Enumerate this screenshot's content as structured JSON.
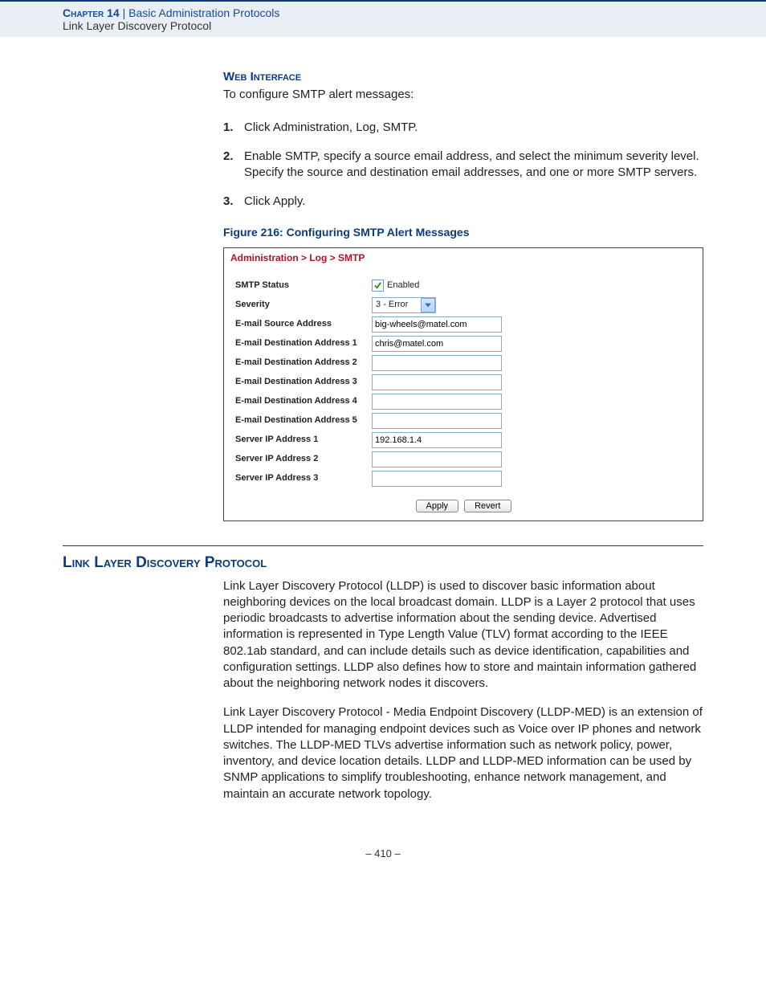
{
  "header": {
    "chapter_label": "Chapter 14",
    "separator": "  |  ",
    "chapter_title": "Basic Administration Protocols",
    "section": "Link Layer Discovery Protocol"
  },
  "web_interface": {
    "heading": "Web Interface",
    "intro": "To configure SMTP alert messages:",
    "steps": [
      "Click Administration, Log, SMTP.",
      "Enable SMTP, specify a source email address, and select the minimum severity level. Specify the source and destination email addresses, and one or more SMTP servers.",
      "Click Apply."
    ]
  },
  "figure": {
    "caption": "Figure 216:  Configuring SMTP Alert Messages",
    "breadcrumb": "Administration > Log > SMTP",
    "rows": {
      "smtp_status": {
        "label": "SMTP Status",
        "checkbox_label": "Enabled",
        "checked": true
      },
      "severity": {
        "label": "Severity",
        "value": "3 - Error"
      },
      "src": {
        "label": "E-mail Source Address",
        "value": "big-wheels@matel.com"
      },
      "dst1": {
        "label": "E-mail Destination Address 1",
        "value": "chris@matel.com"
      },
      "dst2": {
        "label": "E-mail Destination Address 2",
        "value": ""
      },
      "dst3": {
        "label": "E-mail Destination Address 3",
        "value": ""
      },
      "dst4": {
        "label": "E-mail Destination Address 4",
        "value": ""
      },
      "dst5": {
        "label": "E-mail Destination Address 5",
        "value": ""
      },
      "ip1": {
        "label": "Server IP Address 1",
        "value": "192.168.1.4"
      },
      "ip2": {
        "label": "Server IP Address 2",
        "value": ""
      },
      "ip3": {
        "label": "Server IP Address 3",
        "value": ""
      }
    },
    "buttons": {
      "apply": "Apply",
      "revert": "Revert"
    }
  },
  "lldp": {
    "heading": "Link Layer Discovery Protocol",
    "para1": "Link Layer Discovery Protocol (LLDP) is used to discover basic information about neighboring devices on the local broadcast domain. LLDP is a Layer 2 protocol that uses periodic broadcasts to advertise information about the sending device. Advertised information is represented in Type Length Value (TLV) format according to the IEEE 802.1ab standard, and can include details such as device identification, capabilities and configuration settings. LLDP also defines how to store and maintain information gathered about the neighboring network nodes it discovers.",
    "para2": "Link Layer Discovery Protocol - Media Endpoint Discovery (LLDP-MED) is an extension of LLDP intended for managing endpoint devices such as Voice over IP phones and network switches. The LLDP-MED TLVs advertise information such as network policy, power, inventory, and device location details. LLDP and LLDP-MED information can be used by SNMP applications to simplify troubleshooting, enhance network management, and maintain an accurate network topology."
  },
  "footer": {
    "page": "–  410  –"
  }
}
